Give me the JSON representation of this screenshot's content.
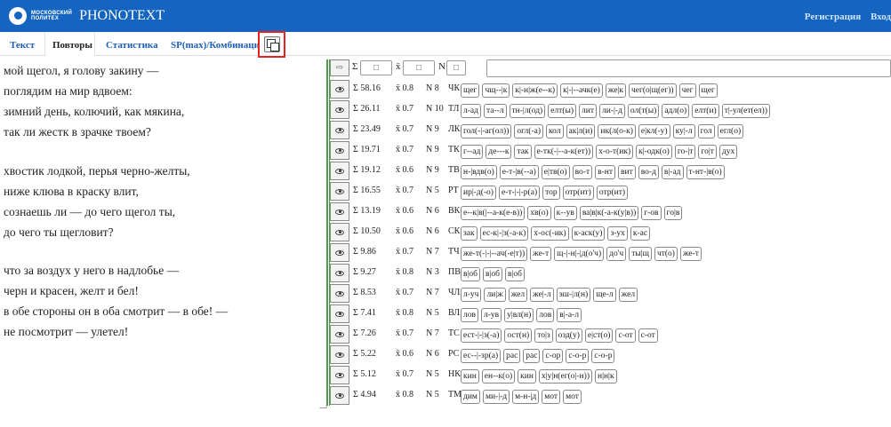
{
  "header": {
    "logo_line1": "МОСКОВСКИЙ",
    "logo_line2": "ПОЛИТЕХ",
    "title": "PHONOTEXT",
    "links": [
      "Регистрация",
      "Вход"
    ],
    "bg_color": "#1565c0"
  },
  "tabs": [
    {
      "label": "Текст",
      "active": false
    },
    {
      "label": "Повторы",
      "active": true
    },
    {
      "label": "Статистика",
      "active": false
    },
    {
      "label": "SP(max)/Комбинации",
      "active": false
    }
  ],
  "copy_button_icon": "copy-icon",
  "poem": [
    "мой щегол, я голову закину —",
    "поглядим на мир вдвоем:",
    "зимний день, колючий, как мякина,",
    "так ли жестк в зрачке твоем?",
    "",
    "хвостик лодкой, перья черно-желты,",
    "ниже клюва в краску влит,",
    "сознаешь ли — до чего щегол ты,",
    "до чего ты щегловит?",
    "",
    "что за воздух у него в надлобье —",
    "черн и красен, желт и бел!",
    "в обе стороны он в оба смотрит — в обе! —",
    "не посмотрит — улетел!"
  ],
  "controls": {
    "arrow_label": "⇨",
    "sigma_label": "Σ",
    "sigma_value": "□",
    "xbar_label": "x̄",
    "xbar_value": "□",
    "n_label": "N",
    "n_value": "□",
    "search_placeholder": ""
  },
  "rows": [
    {
      "sigma": "Σ 58.16",
      "xbar": "x̄ 0.8",
      "n": "N 8",
      "code": "ЧК",
      "chips": [
        "щег",
        "чщ--|к",
        "к|-н|ж(е--к)",
        "к|-|--ачк(е)",
        "же|к",
        "чег(о|щ(ег))",
        "чег",
        "щег"
      ]
    },
    {
      "sigma": "Σ 26.11",
      "xbar": "x̄ 0.7",
      "n": "N 10",
      "code": "ТЛ",
      "chips": [
        "л-ад",
        "та--л",
        "тн-|л(од)",
        "елт(ы)",
        "лит",
        "ли-|-д",
        "ол(т(ы)",
        "адл(о)",
        "елт(и)",
        "т|-ул(ет(ел))"
      ]
    },
    {
      "sigma": "Σ 23.49",
      "xbar": "x̄ 0.7",
      "n": "N 9",
      "code": "ЛК",
      "chips": [
        "гол(-|-аг(ол))",
        "огл(-а)",
        "кол",
        "ак|л(и)",
        "ик(л(о-к)",
        "е|кл(-у)",
        "ку|-л",
        "гол",
        "егл(о)"
      ]
    },
    {
      "sigma": "Σ 19.71",
      "xbar": "x̄ 0.7",
      "n": "N 9",
      "code": "ТК",
      "chips": [
        "г--ад",
        "де---к",
        "так",
        "е-тк(-|--а-к(ет))",
        "х-о-т(ик)",
        "к|-одк(о)",
        "го-|т",
        "го|т",
        "дух"
      ]
    },
    {
      "sigma": "Σ 19.12",
      "xbar": "x̄ 0.6",
      "n": "N 9",
      "code": "ТВ",
      "chips": [
        "н-|вдв(о)",
        "е-т-|в(--а)",
        "е|тв(о)",
        "во-т",
        "в-нт",
        "вит",
        "во-д",
        "в|-ад",
        "т-нт-|в(о)"
      ]
    },
    {
      "sigma": "Σ 16.55",
      "xbar": "x̄ 0.7",
      "n": "N 5",
      "code": "РТ",
      "chips": [
        "ир|-д(-о)",
        "е-т-|-|-р(а)",
        "тор",
        "отр(ит)",
        "отр(ит)"
      ]
    },
    {
      "sigma": "Σ 13.19",
      "xbar": "x̄ 0.6",
      "n": "N 6",
      "code": "ВК",
      "chips": [
        "е--к|в(|--а-к(е-в))",
        "хв(о)",
        "к--ув",
        "ва|в|к(-а-к(у|в))",
        "г-ов",
        "го|в"
      ]
    },
    {
      "sigma": "Σ 10.50",
      "xbar": "x̄ 0.6",
      "n": "N 6",
      "code": "СК",
      "chips": [
        "зак",
        "ес-к|-|з(-а-к)",
        "х-ос(-ик)",
        "к-аск(у)",
        "з-ух",
        "к-ас"
      ]
    },
    {
      "sigma": "Σ 9.86",
      "xbar": "x̄ 0.7",
      "n": "N 7",
      "code": "ТЧ",
      "chips": [
        "же-т(-|-|--ач(-е|т))",
        "же-т",
        "щ-|-н|-|д(о'ч)",
        "до'ч",
        "ты|щ",
        "чт(о)",
        "же-т"
      ]
    },
    {
      "sigma": "Σ 9.27",
      "xbar": "x̄ 0.8",
      "n": "N 3",
      "code": "ПВ",
      "chips": [
        "в|об",
        "в|об",
        "в|об"
      ]
    },
    {
      "sigma": "Σ 8.53",
      "xbar": "x̄ 0.7",
      "n": "N 7",
      "code": "ЧЛ",
      "chips": [
        "л-уч",
        "ли|ж",
        "жел",
        "же|-л",
        "эш-|л(н)",
        "ще-л",
        "жел"
      ]
    },
    {
      "sigma": "Σ 7.41",
      "xbar": "x̄ 0.8",
      "n": "N 5",
      "code": "ВЛ",
      "chips": [
        "лов",
        "л-ув",
        "у|вл(н)",
        "лов",
        "в|-а-л"
      ]
    },
    {
      "sigma": "Σ 7.26",
      "xbar": "x̄ 0.7",
      "n": "N 7",
      "code": "ТС",
      "chips": [
        "ест-|-|з(-а)",
        "ост(н)",
        "то|з",
        "озд(у)",
        "е|ст(о)",
        "с-от",
        "с-от"
      ]
    },
    {
      "sigma": "Σ 5.22",
      "xbar": "x̄ 0.6",
      "n": "N 6",
      "code": "РС",
      "chips": [
        "ес--|-зр(а)",
        "рас",
        "рас",
        "с-ор",
        "с-о-р",
        "с-о-р"
      ]
    },
    {
      "sigma": "Σ 5.12",
      "xbar": "x̄ 0.7",
      "n": "N 5",
      "code": "НК",
      "chips": [
        "кин",
        "ен--к(о)",
        "кин",
        "х|у|н(ег(о|-н))",
        "н|н|к"
      ]
    },
    {
      "sigma": "Σ 4.94",
      "xbar": "x̄ 0.8",
      "n": "N 5",
      "code": "ТМ",
      "chips": [
        "дим",
        "ми-|-д",
        "м-н-|д",
        "мот",
        "мот"
      ]
    }
  ]
}
